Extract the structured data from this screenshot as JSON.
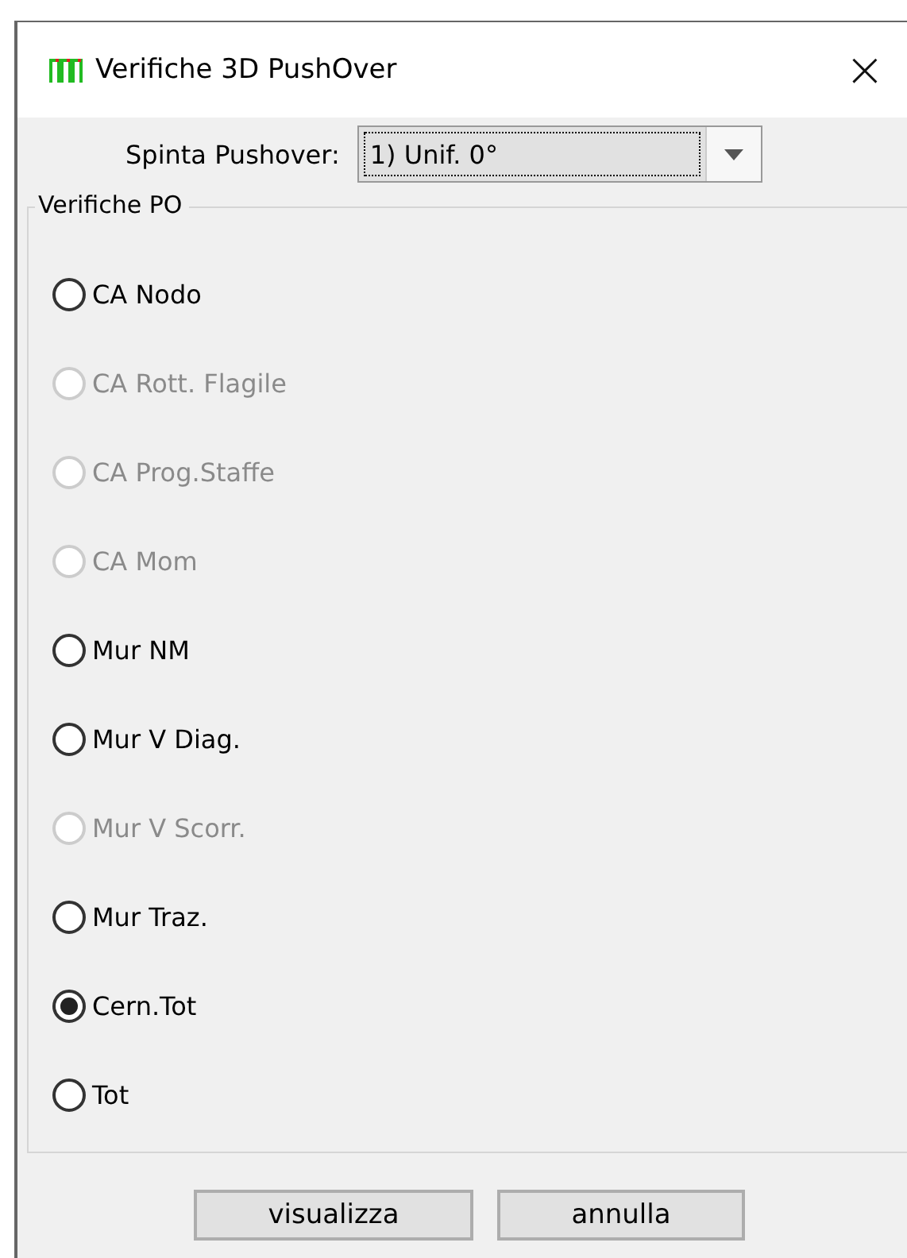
{
  "window": {
    "title": "Verifiche 3D PushOver",
    "close": "×"
  },
  "spinta": {
    "label": "Spinta Pushover:",
    "value": "1) Unif. 0°"
  },
  "group": {
    "title": "Verifiche PO",
    "options": [
      {
        "label": "CA Nodo",
        "selected": false,
        "disabled": false
      },
      {
        "label": "CA Rott. Flagile",
        "selected": false,
        "disabled": true
      },
      {
        "label": "CA Prog.Staffe",
        "selected": false,
        "disabled": true
      },
      {
        "label": "CA Mom",
        "selected": false,
        "disabled": true
      },
      {
        "label": "Mur NM",
        "selected": false,
        "disabled": false
      },
      {
        "label": "Mur V Diag.",
        "selected": false,
        "disabled": false
      },
      {
        "label": "Mur V Scorr.",
        "selected": false,
        "disabled": true
      },
      {
        "label": "Mur Traz.",
        "selected": false,
        "disabled": false
      },
      {
        "label": "Cern.Tot",
        "selected": true,
        "disabled": false
      },
      {
        "label": "Tot",
        "selected": false,
        "disabled": false
      }
    ]
  },
  "buttons": [
    "visualizza",
    "annulla"
  ]
}
